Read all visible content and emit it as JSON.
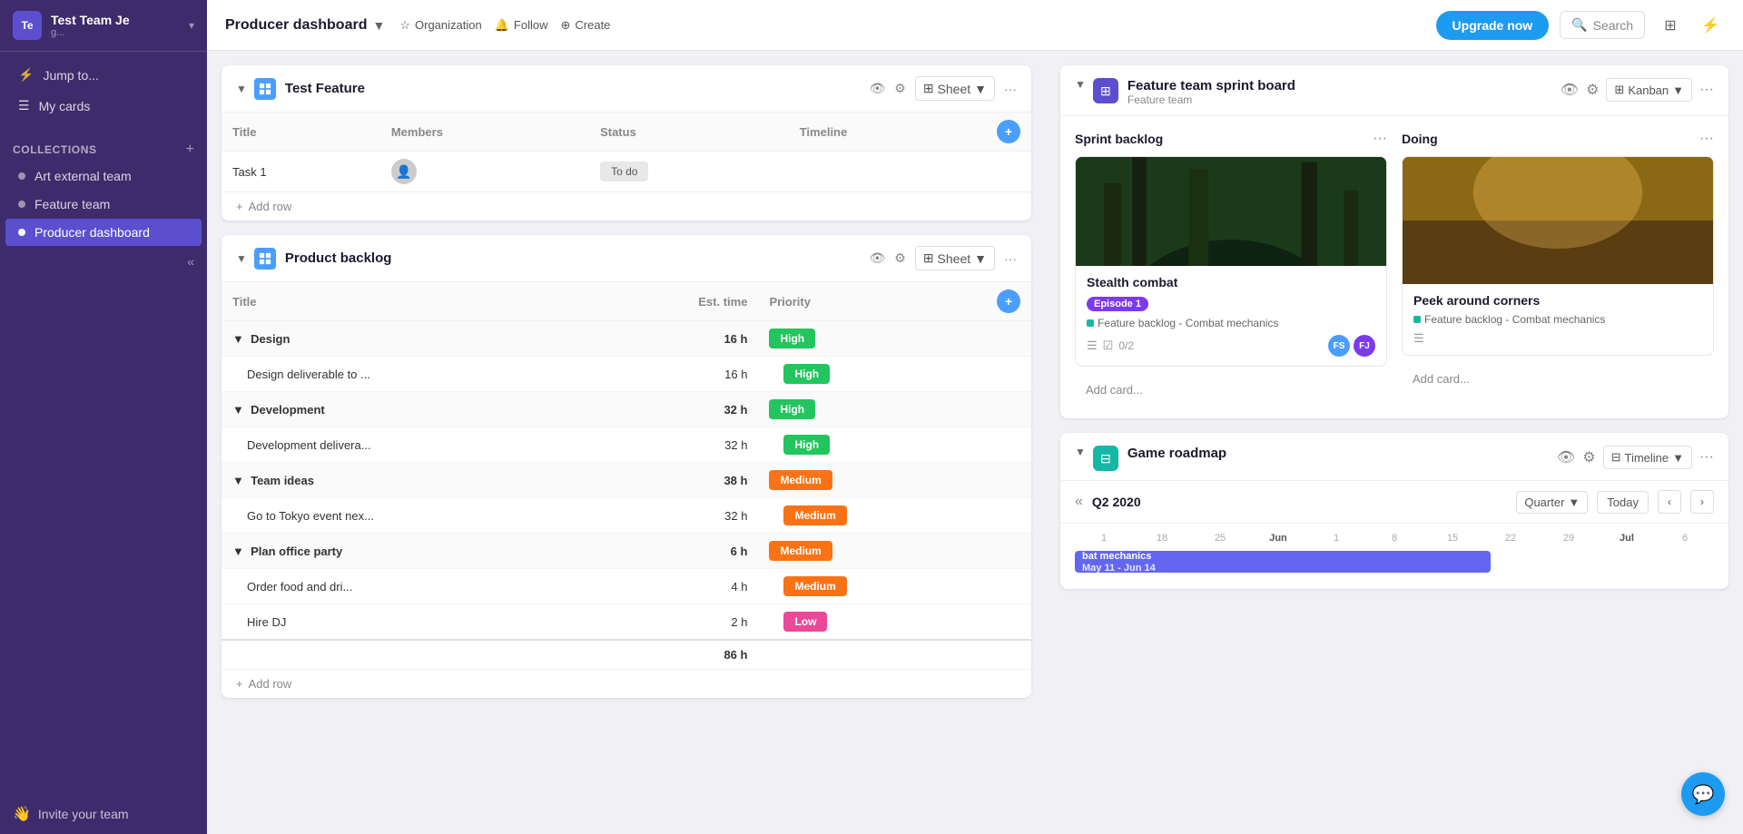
{
  "sidebar": {
    "team_avatar": "Te",
    "team_name": "Test Team Je",
    "team_sub": "g...",
    "jump_to": "Jump to...",
    "my_cards": "My cards",
    "collections_label": "Collections",
    "collections": [
      {
        "id": "art-external",
        "label": "Art external team",
        "active": false
      },
      {
        "id": "feature-team",
        "label": "Feature team",
        "active": false
      },
      {
        "id": "producer-dashboard",
        "label": "Producer dashboard",
        "active": true
      }
    ],
    "invite_team": "Invite your team"
  },
  "topbar": {
    "title": "Producer dashboard",
    "title_icon": "▼",
    "star_label": "Organization",
    "follow_label": "Follow",
    "create_label": "Create",
    "upgrade_label": "Upgrade now",
    "search_placeholder": "Search"
  },
  "left_panel": {
    "test_feature": {
      "title": "Test Feature",
      "view_label": "Sheet",
      "columns": [
        "Title",
        "Members",
        "Status",
        "Timeline"
      ],
      "rows": [
        {
          "title": "Task 1",
          "members": "",
          "status": "To do",
          "timeline": ""
        }
      ],
      "add_row": "Add row"
    },
    "product_backlog": {
      "title": "Product backlog",
      "view_label": "Sheet",
      "columns": [
        "Title",
        "Est. time",
        "Priority"
      ],
      "groups": [
        {
          "name": "Design",
          "time": "16 h",
          "priority": "High",
          "priority_class": "high",
          "sub_items": [
            {
              "title": "Design deliverable to ...",
              "time": "16 h",
              "priority": "High",
              "priority_class": "high"
            }
          ]
        },
        {
          "name": "Development",
          "time": "32 h",
          "priority": "High",
          "priority_class": "high",
          "sub_items": [
            {
              "title": "Development delivera...",
              "time": "32 h",
              "priority": "High",
              "priority_class": "high"
            }
          ]
        },
        {
          "name": "Team ideas",
          "time": "38 h",
          "priority": "Medium",
          "priority_class": "medium",
          "sub_items": [
            {
              "title": "Go to Tokyo event nex...",
              "time": "32 h",
              "priority": "Medium",
              "priority_class": "medium"
            }
          ]
        },
        {
          "name": "Plan office party",
          "time": "6 h",
          "priority": "Medium",
          "priority_class": "medium",
          "sub_items": [
            {
              "title": "Order food and dri...",
              "time": "4 h",
              "priority": "Medium",
              "priority_class": "medium"
            },
            {
              "title": "Hire DJ",
              "time": "2 h",
              "priority": "Low",
              "priority_class": "low"
            }
          ]
        }
      ],
      "total_time": "86 h",
      "add_row": "Add row"
    }
  },
  "right_panel": {
    "sprint_board": {
      "title": "Feature team sprint board",
      "sub": "Feature team",
      "view_label": "Kanban",
      "columns": [
        {
          "title": "Sprint backlog",
          "cards": [
            {
              "title": "Stealth combat",
              "episode": "Episode 1",
              "tag": "Feature backlog - Combat mechanics",
              "checklist": "0/2",
              "avatars": [
                "FS",
                "FJ"
              ],
              "avatar_colors": [
                "#4a9eff",
                "#7c3aed"
              ]
            }
          ],
          "add_card": "Add card..."
        },
        {
          "title": "Doing",
          "cards": [
            {
              "title": "Peek around corners",
              "tag": "Feature backlog - Combat mechanics",
              "avatars": [],
              "avatar_colors": []
            }
          ],
          "add_card": "Add card..."
        }
      ]
    },
    "game_roadmap": {
      "title": "Game roadmap",
      "view_label": "Timeline",
      "period": "Q2 2020",
      "quarter": "Quarter",
      "today": "Today",
      "dates": [
        "1",
        "18",
        "25",
        "Jun",
        "1",
        "8",
        "15",
        "22",
        "29",
        "Jul",
        "6"
      ],
      "bar_label": "bat mechanics",
      "bar_dates": "May 11 - Jun 14"
    }
  }
}
